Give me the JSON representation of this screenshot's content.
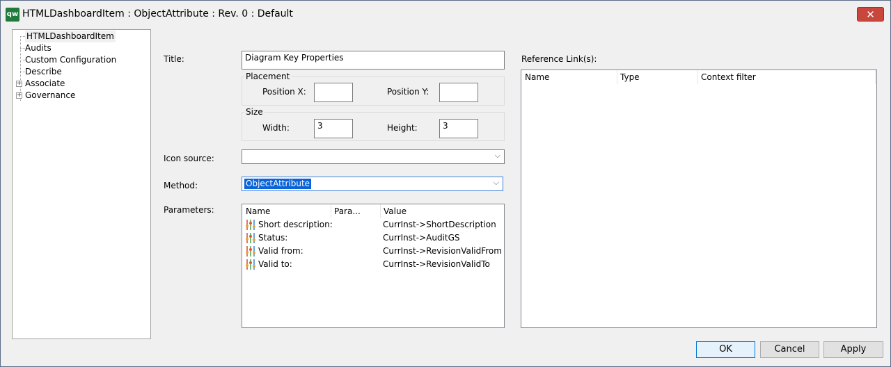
{
  "window": {
    "app_icon_text": "qw",
    "title": "HTMLDashboardItem : ObjectAttribute : Rev. 0  : Default",
    "close_glyph": "✕"
  },
  "tree": {
    "items": [
      {
        "label": "HTMLDashboardItem",
        "expandable": false,
        "selected": true
      },
      {
        "label": "Audits",
        "expandable": false
      },
      {
        "label": "Custom Configuration",
        "expandable": false
      },
      {
        "label": "Describe",
        "expandable": false
      },
      {
        "label": "Associate",
        "expandable": true
      },
      {
        "label": "Governance",
        "expandable": true
      }
    ],
    "expander_glyph": "+"
  },
  "form": {
    "title_label": "Title:",
    "title_value": "Diagram Key Properties",
    "placement": {
      "caption": "Placement",
      "x_label": "Position X:",
      "x_value": "",
      "y_label": "Position Y:",
      "y_value": ""
    },
    "size": {
      "caption": "Size",
      "width_label": "Width:",
      "width_value": "3",
      "height_label": "Height:",
      "height_value": "3"
    },
    "icon_source_label": "Icon source:",
    "icon_source_value": "",
    "method_label": "Method:",
    "method_value": "ObjectAttribute",
    "chevron_glyph": "⌵",
    "parameters_label": "Parameters:",
    "parameters": {
      "columns": [
        "Name",
        "Para...",
        "Value"
      ],
      "rows": [
        {
          "name": "Short description:",
          "param": "",
          "value": "CurrInst->ShortDescription"
        },
        {
          "name": "Status:",
          "param": "",
          "value": "CurrInst->AuditGS"
        },
        {
          "name": "Valid from:",
          "param": "",
          "value": "CurrInst->RevisionValidFrom"
        },
        {
          "name": "Valid to:",
          "param": "",
          "value": "CurrInst->RevisionValidTo"
        }
      ],
      "row_icon": "parameter-icon"
    }
  },
  "references": {
    "label": "Reference Link(s):",
    "columns": [
      "Name",
      "Type",
      "Context filter"
    ]
  },
  "buttons": {
    "ok": "OK",
    "cancel": "Cancel",
    "apply": "Apply"
  },
  "colors": {
    "selection": "#0a64d8",
    "close_button": "#c9463d",
    "default_button_border": "#0078d7"
  }
}
